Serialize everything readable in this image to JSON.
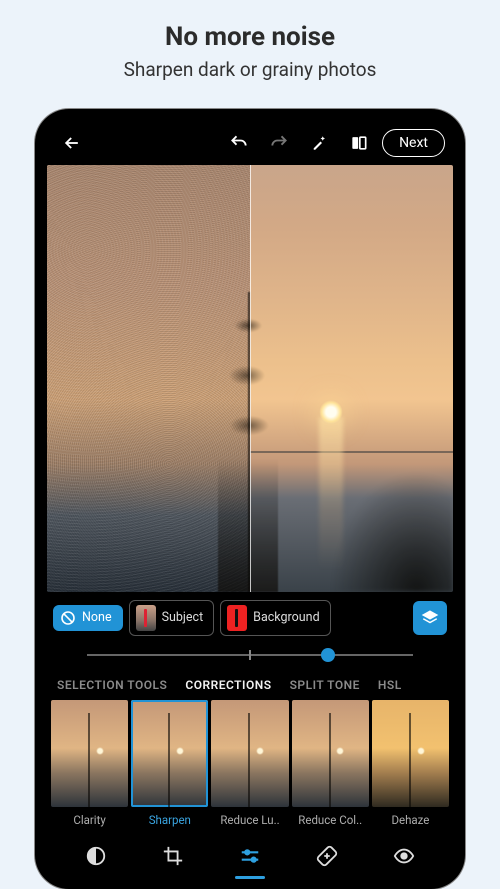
{
  "promo": {
    "title": "No more noise",
    "subtitle": "Sharpen dark or grainy photos"
  },
  "topbar": {
    "next_label": "Next"
  },
  "mask": {
    "none_label": "None",
    "subject_label": "Subject",
    "background_label": "Background"
  },
  "slider": {
    "value_pct": 74
  },
  "tabs": [
    {
      "id": "selection",
      "label": "SELECTION TOOLS",
      "active": false
    },
    {
      "id": "corrections",
      "label": "CORRECTIONS",
      "active": true
    },
    {
      "id": "splittone",
      "label": "SPLIT TONE",
      "active": false
    },
    {
      "id": "hsl",
      "label": "HSL",
      "active": false
    }
  ],
  "filters": [
    {
      "id": "clarity",
      "label": "Clarity",
      "selected": false
    },
    {
      "id": "sharpen",
      "label": "Sharpen",
      "selected": true
    },
    {
      "id": "reducelum",
      "label": "Reduce Lu..",
      "selected": false
    },
    {
      "id": "reducecol",
      "label": "Reduce Col..",
      "selected": false
    },
    {
      "id": "dehaze",
      "label": "Dehaze",
      "selected": false
    }
  ],
  "nav": {
    "active": "adjust",
    "items": [
      "looks",
      "crop",
      "adjust",
      "heal",
      "redeye"
    ]
  },
  "icons": {
    "back": "back-arrow-icon",
    "undo": "undo-icon",
    "redo": "redo-icon",
    "wand": "magic-wand-icon",
    "compare": "before-after-icon",
    "layers": "layers-icon",
    "noentry": "no-entry-icon",
    "looks": "looks-icon",
    "crop": "crop-icon",
    "adjust": "sliders-icon",
    "heal": "heal-icon",
    "eye": "eye-icon"
  }
}
